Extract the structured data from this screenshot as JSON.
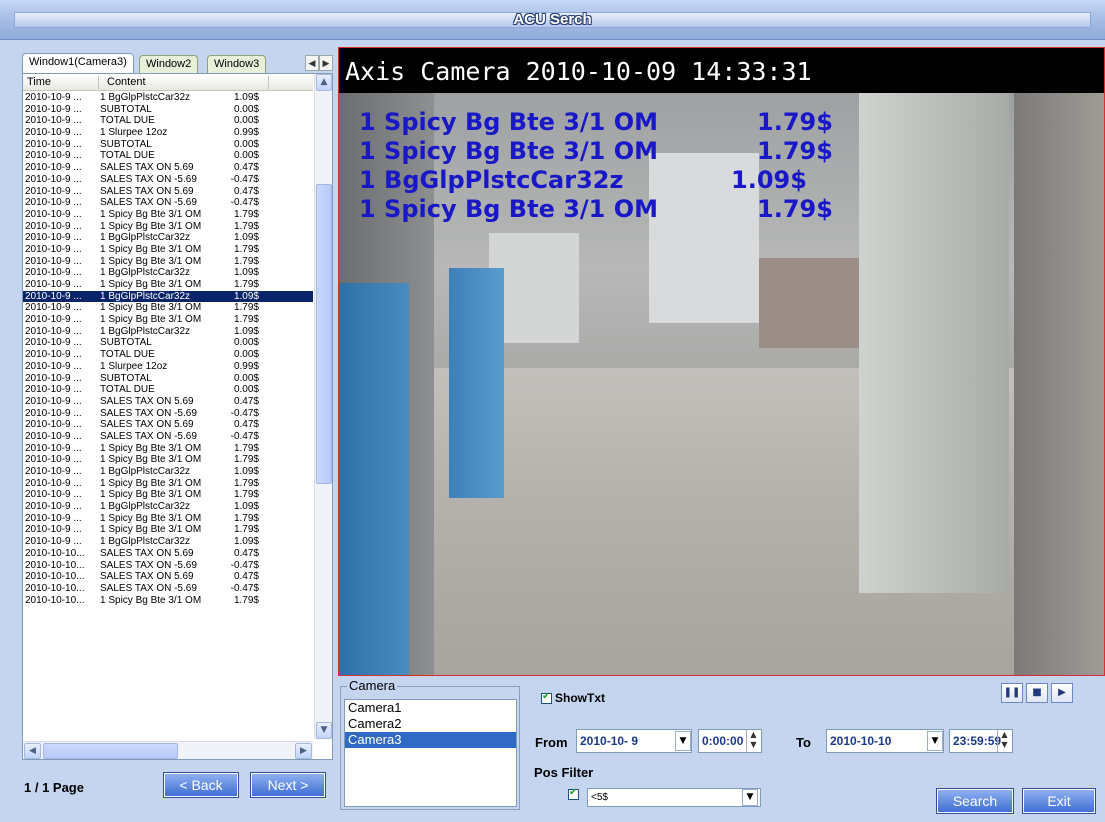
{
  "window": {
    "title": "ACU Serch"
  },
  "tabs": [
    "Window1(Camera3)",
    "Window2",
    "Window3"
  ],
  "list": {
    "columns": [
      "Time",
      "Content"
    ],
    "selected_index": 17,
    "rows": [
      {
        "time": "2010-10-9 ...",
        "content": "1  BgGlpPlstcCar32z",
        "price": "1.09$"
      },
      {
        "time": "2010-10-9 ...",
        "content": "SUBTOTAL",
        "price": "0.00$"
      },
      {
        "time": "2010-10-9 ...",
        "content": "TOTAL DUE",
        "price": "0.00$"
      },
      {
        "time": "2010-10-9 ...",
        "content": "1  Slurpee 12oz",
        "price": "0.99$"
      },
      {
        "time": "2010-10-9 ...",
        "content": "SUBTOTAL",
        "price": "0.00$"
      },
      {
        "time": "2010-10-9 ...",
        "content": "TOTAL DUE",
        "price": "0.00$"
      },
      {
        "time": "2010-10-9 ...",
        "content": "SALES TAX ON 5.69",
        "price": "0.47$"
      },
      {
        "time": "2010-10-9 ...",
        "content": "SALES TAX ON -5.69",
        "price": "-0.47$"
      },
      {
        "time": "2010-10-9 ...",
        "content": "SALES TAX ON 5.69",
        "price": "0.47$"
      },
      {
        "time": "2010-10-9 ...",
        "content": "SALES TAX ON -5.69",
        "price": "-0.47$"
      },
      {
        "time": "2010-10-9 ...",
        "content": "1  Spicy Bg Bte 3/1 OM",
        "price": "1.79$"
      },
      {
        "time": "2010-10-9 ...",
        "content": "1  Spicy Bg Bte 3/1 OM",
        "price": "1.79$"
      },
      {
        "time": "2010-10-9 ...",
        "content": "1  BgGlpPlstcCar32z",
        "price": "1.09$"
      },
      {
        "time": "2010-10-9 ...",
        "content": "1  Spicy Bg Bte 3/1 OM",
        "price": "1.79$"
      },
      {
        "time": "2010-10-9 ...",
        "content": "1  Spicy Bg Bte 3/1 OM",
        "price": "1.79$"
      },
      {
        "time": "2010-10-9 ...",
        "content": "1  BgGlpPlstcCar32z",
        "price": "1.09$"
      },
      {
        "time": "2010-10-9 ...",
        "content": "1  Spicy Bg Bte 3/1 OM",
        "price": "1.79$"
      },
      {
        "time": "2010-10-9 ...",
        "content": "1  BgGlpPlstcCar32z",
        "price": "1.09$"
      },
      {
        "time": "2010-10-9 ...",
        "content": "1  Spicy Bg Bte 3/1 OM",
        "price": "1.79$"
      },
      {
        "time": "2010-10-9 ...",
        "content": "1  Spicy Bg Bte 3/1 OM",
        "price": "1.79$"
      },
      {
        "time": "2010-10-9 ...",
        "content": "1  BgGlpPlstcCar32z",
        "price": "1.09$"
      },
      {
        "time": "2010-10-9 ...",
        "content": "SUBTOTAL",
        "price": "0.00$"
      },
      {
        "time": "2010-10-9 ...",
        "content": "TOTAL DUE",
        "price": "0.00$"
      },
      {
        "time": "2010-10-9 ...",
        "content": "1  Slurpee 12oz",
        "price": "0.99$"
      },
      {
        "time": "2010-10-9 ...",
        "content": "SUBTOTAL",
        "price": "0.00$"
      },
      {
        "time": "2010-10-9 ...",
        "content": "TOTAL DUE",
        "price": "0.00$"
      },
      {
        "time": "2010-10-9 ...",
        "content": "SALES TAX ON 5.69",
        "price": "0.47$"
      },
      {
        "time": "2010-10-9 ...",
        "content": "SALES TAX ON -5.69",
        "price": "-0.47$"
      },
      {
        "time": "2010-10-9 ...",
        "content": "SALES TAX ON 5.69",
        "price": "0.47$"
      },
      {
        "time": "2010-10-9 ...",
        "content": "SALES TAX ON -5.69",
        "price": "-0.47$"
      },
      {
        "time": "2010-10-9 ...",
        "content": "1  Spicy Bg Bte 3/1 OM",
        "price": "1.79$"
      },
      {
        "time": "2010-10-9 ...",
        "content": "1  Spicy Bg Bte 3/1 OM",
        "price": "1.79$"
      },
      {
        "time": "2010-10-9 ...",
        "content": "1  BgGlpPlstcCar32z",
        "price": "1.09$"
      },
      {
        "time": "2010-10-9 ...",
        "content": "1  Spicy Bg Bte 3/1 OM",
        "price": "1.79$"
      },
      {
        "time": "2010-10-9 ...",
        "content": "1  Spicy Bg Bte 3/1 OM",
        "price": "1.79$"
      },
      {
        "time": "2010-10-9 ...",
        "content": "1  BgGlpPlstcCar32z",
        "price": "1.09$"
      },
      {
        "time": "2010-10-9 ...",
        "content": "1  Spicy Bg Bte 3/1 OM",
        "price": "1.79$"
      },
      {
        "time": "2010-10-9 ...",
        "content": "1  Spicy Bg Bte 3/1 OM",
        "price": "1.79$"
      },
      {
        "time": "2010-10-9 ...",
        "content": "1  BgGlpPlstcCar32z",
        "price": "1.09$"
      },
      {
        "time": "2010-10-10...",
        "content": "SALES TAX ON 5.69",
        "price": "0.47$"
      },
      {
        "time": "2010-10-10...",
        "content": "SALES TAX ON -5.69",
        "price": "-0.47$"
      },
      {
        "time": "2010-10-10...",
        "content": "SALES TAX ON 5.69",
        "price": "0.47$"
      },
      {
        "time": "2010-10-10...",
        "content": "SALES TAX ON -5.69",
        "price": "-0.47$"
      },
      {
        "time": "2010-10-10...",
        "content": "1  Spicy Bg Bte 3/1 OM",
        "price": "1.79$"
      }
    ]
  },
  "pagination": {
    "page_info": "1 / 1 Page",
    "back_label": "< Back",
    "next_label": "Next >"
  },
  "video": {
    "osd": "Axis Camera 2010-10-09 14:33:31",
    "overlay_lines": [
      {
        "item": "1  Spicy Bg Bte 3/1 OM",
        "price": "1.79$"
      },
      {
        "item": "1  Spicy Bg Bte 3/1 OM",
        "price": "1.79$"
      },
      {
        "item": "1  BgGlpPlstcCar32z",
        "price": "1.09$"
      },
      {
        "item": "1  Spicy Bg Bte 3/1 OM",
        "price": "1.79$"
      }
    ],
    "overlay_color": "#1818c8"
  },
  "camera": {
    "legend": "Camera",
    "items": [
      "Camera1",
      "Camera2",
      "Camera3"
    ],
    "selected": "Camera3"
  },
  "controls": {
    "show_txt_label": "ShowTxt",
    "from_label": "From",
    "from_date": "2010-10- 9",
    "from_time": "0:00:00",
    "to_label": "To",
    "to_date": "2010-10-10",
    "to_time": "23:59:59",
    "pos_filter_label": "Pos Filter",
    "pos_filter_value": "<5$"
  },
  "buttons": {
    "search": "Search",
    "exit": "Exit"
  },
  "icons": {
    "pause": "pause-icon",
    "stop": "stop-icon",
    "play": "play-step-icon"
  },
  "colors": {
    "accent": "#316ac5",
    "selected_row": "#0a246a",
    "background": "#c5d4ef",
    "button": "#3f6fd4"
  }
}
